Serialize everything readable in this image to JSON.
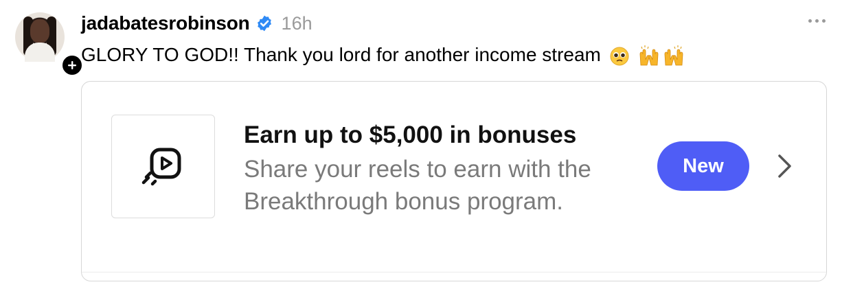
{
  "post": {
    "username": "jadabatesrobinson",
    "verified": true,
    "time": "16h",
    "caption": "GLORY TO GOD!! Thank you lord for another income stream",
    "caption_emojis": [
      "pleading-face",
      "raising-hands",
      "raising-hands"
    ]
  },
  "card": {
    "icon": "reels-bonus-icon",
    "title": "Earn up to $5,000 in bonuses",
    "description": "Share your reels to earn with the Breakthrough bonus program.",
    "badge": "New"
  },
  "colors": {
    "accent": "#4f5df6",
    "verified": "#2f8af5",
    "muted": "#9a9a9a",
    "description": "#7a7a7a"
  }
}
